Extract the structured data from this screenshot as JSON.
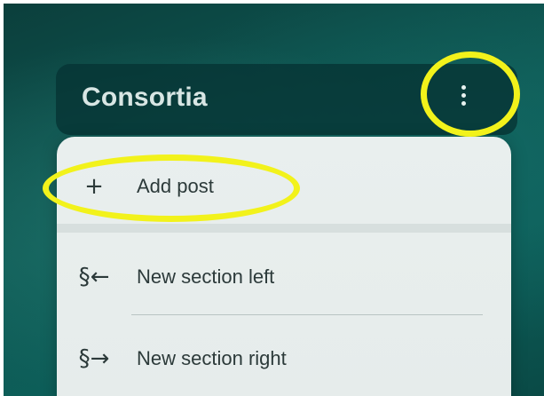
{
  "board": {
    "title": "Consortia",
    "more_icon": "vertical-ellipsis-icon"
  },
  "menu": {
    "items": [
      {
        "label": "Add post",
        "icon": "plus-icon",
        "glyph": "+"
      },
      {
        "label": "New section left",
        "icon": "section-left-icon",
        "glyph": "§←"
      },
      {
        "label": "New section right",
        "icon": "section-right-icon",
        "glyph": "§→"
      }
    ]
  },
  "colors": {
    "highlight": "#f2f21b",
    "header_bg": "#063434",
    "menu_bg": "#e9efee",
    "text_dark": "#2c3a3a",
    "title_text": "#d8e6e4"
  }
}
